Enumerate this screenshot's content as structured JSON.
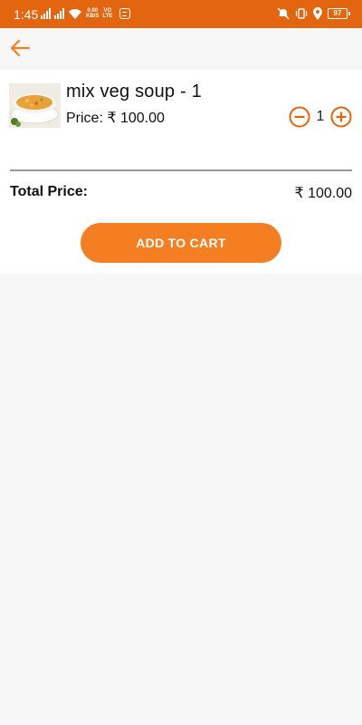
{
  "status_bar": {
    "time": "1:45",
    "speed_value": "0.00",
    "speed_unit": "KB/S",
    "network_top": "VO",
    "network_bottom": "LTE",
    "battery": "97",
    "icons": [
      "signal-icon",
      "wifi-icon",
      "notification-icon",
      "mute-icon",
      "vibrate-icon",
      "location-icon",
      "battery-icon"
    ]
  },
  "app_bar": {
    "back_icon": "arrow-left-icon"
  },
  "cart_item": {
    "name": "mix veg soup - 1",
    "price": "Price: ₹ 100.00",
    "quantity": "1"
  },
  "total": {
    "label": "Total Price:",
    "value": "₹ 100.00"
  },
  "actions": {
    "add_to_cart": "ADD TO CART"
  },
  "colors": {
    "status_bar": "#e3650f",
    "accent": "#f47e22",
    "background": "#f7f7f7",
    "card": "#ffffff",
    "text": "#111111"
  }
}
